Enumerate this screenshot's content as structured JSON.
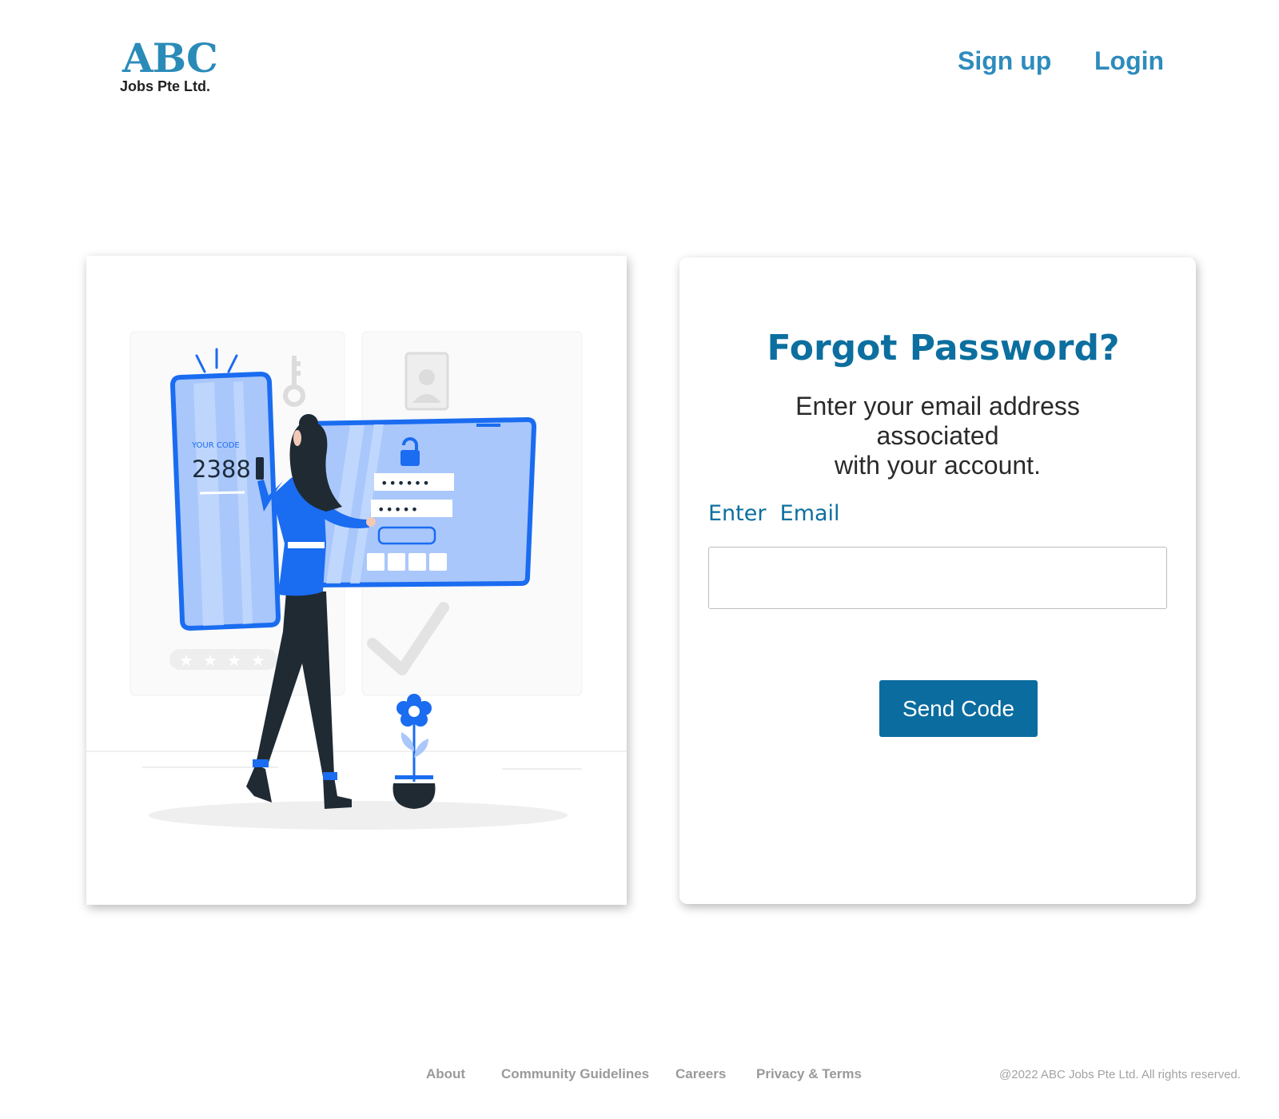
{
  "header": {
    "logo_mark": "ABC",
    "logo_sub": "Jobs Pte Ltd.",
    "nav": {
      "signup_label": "Sign up",
      "login_label": "Login"
    }
  },
  "illustration": {
    "code_label": "YOUR CODE",
    "code_value": "2388",
    "password_mask_1": "••••••",
    "password_mask_2": "•••••"
  },
  "form": {
    "title": "Forgot Password?",
    "description_lines": [
      "Enter your email address",
      "associated",
      "with your account."
    ],
    "email_label": "Enter  Email",
    "email_value": "",
    "email_placeholder": "",
    "submit_label": "Send Code"
  },
  "footer": {
    "links": [
      "About",
      "Community Guidelines",
      "Careers",
      "Privacy & Terms"
    ],
    "copyright": "@2022 ABC Jobs Pte Ltd. All rights reserved."
  },
  "colors": {
    "brand_blue": "#0b6c9f",
    "nav_blue": "#2e8bbd",
    "illustration_blue": "#1a6cf0",
    "footer_gray": "#9a9a9a"
  },
  "icons": [
    "key-icon",
    "user-profile-icon",
    "padlock-icon",
    "checkmark-icon",
    "flower-icon"
  ]
}
